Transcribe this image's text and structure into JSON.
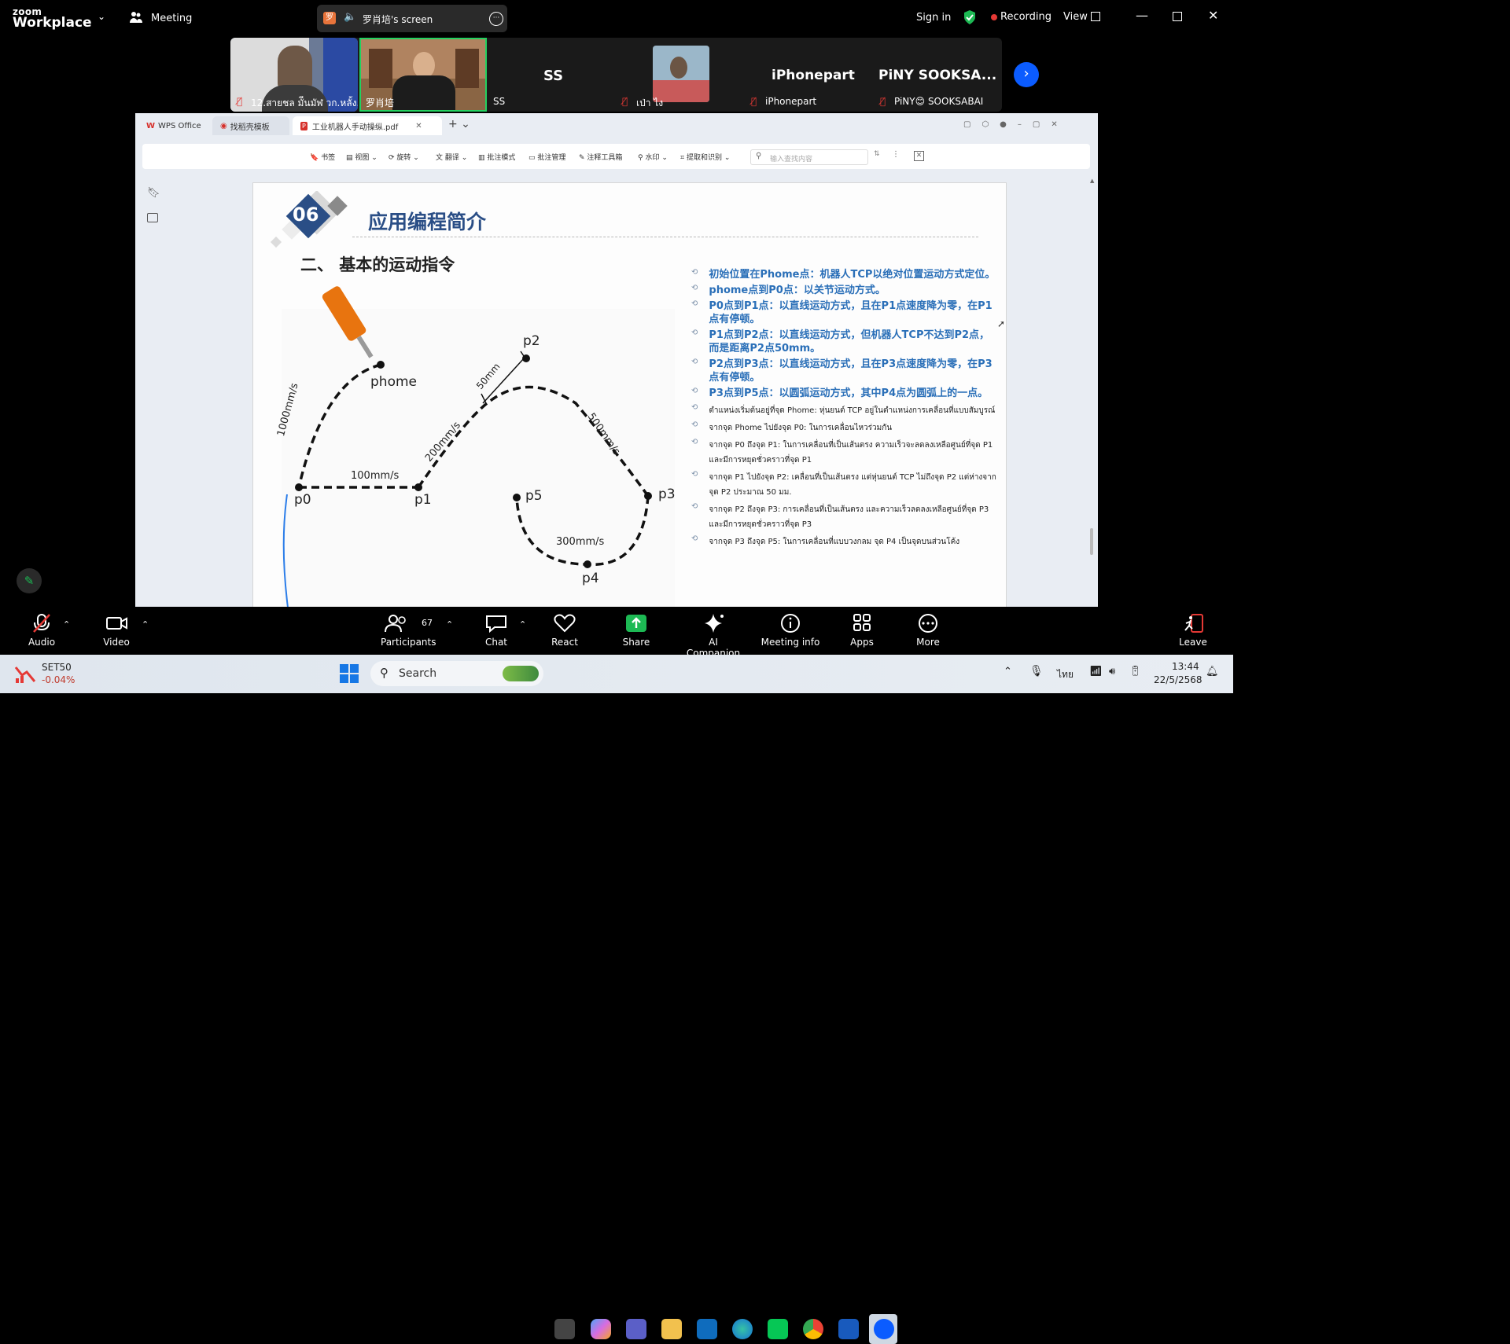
{
  "app": {
    "logo_top": "zoom",
    "logo_bottom": "Workplace",
    "meeting_label": "Meeting",
    "share_title": "罗肖培's screen",
    "sign_in": "Sign in",
    "recording": "Recording",
    "view": "View"
  },
  "thumbnails": [
    {
      "name": "12.สายชล มัีนมัฬ วก.หลั้ง...",
      "muted": true
    },
    {
      "name": "罗肖培",
      "muted": true,
      "active": true
    },
    {
      "name": "SS",
      "big": "SS",
      "muted": false
    },
    {
      "name": "เป่า ไง",
      "muted": true
    },
    {
      "name": "iPhonepart",
      "big": "iPhonepart",
      "muted": true
    },
    {
      "name": "PiNY😊 SOOKSABAI",
      "big": "PiNY󠁿 SOOKSA...",
      "muted": true
    }
  ],
  "wps": {
    "tabs": [
      "WPS Office",
      "找稻壳模板",
      "工业机器人手动操纵.pdf"
    ],
    "tools": [
      "书签",
      "视图",
      "旋转",
      "翻译",
      "批注模式",
      "批注管理",
      "注释工具箱",
      "水印",
      "提取和识别"
    ],
    "search_placeholder": "输入查找内容"
  },
  "slide": {
    "number": "06",
    "title": "应用编程简介",
    "subtitle": "二、 基本的运动指令",
    "diagram": {
      "points": [
        "phome",
        "p0",
        "p1",
        "p2",
        "p3",
        "p4",
        "p5"
      ],
      "speeds": [
        "1000mm/s",
        "100mm/s",
        "200mm/s",
        "50mm",
        "500mm/s",
        "300mm/s"
      ]
    },
    "bullets_cn": [
      "初始位置在Phome点：机器人TCP以绝对位置运动方式定位。",
      "phome点到P0点：以关节运动方式。",
      "P0点到P1点：以直线运动方式，且在P1点速度降为零，在P1点有停顿。",
      "P1点到P2点：以直线运动方式，但机器人TCP不达到P2点，而是距离P2点50mm。",
      "P2点到P3点：以直线运动方式，且在P3点速度降为零，在P3点有停顿。",
      "P3点到P5点：以圆弧运动方式，其中P4点为圆弧上的一点。"
    ],
    "bullets_th": [
      "ตำแหน่งเริ่มต้นอยู่ที่จุด Phome: หุ่นยนต์ TCP อยู่ในตำแหน่งการเคลื่อนที่แบบสัมบูรณ์",
      "จากจุด Phome ไปยังจุด P0: ในการเคลื่อนไหวร่วมกัน",
      "จากจุด P0 ถึงจุด P1: ในการเคลื่อนที่เป็นเส้นตรง ความเร็วจะลดลงเหลือศูนย์ที่จุด P1 และมีการหยุดชั่วคราวที่จุด P1",
      "จากจุด P1 ไปยังจุด P2: เคลื่อนที่เป็นเส้นตรง แต่หุ่นยนต์ TCP ไม่ถึงจุด P2 แต่ห่างจากจุด P2 ประมาณ 50 มม.",
      "จากจุด P2 ถึงจุด P3: การเคลื่อนที่เป็นเส้นตรง และความเร็วลดลงเหลือศูนย์ที่จุด P3 และมีการหยุดชั่วคราวที่จุด P3",
      "จากจุด P3 ถึงจุด P5: ในการเคลื่อนที่แบบวงกลม จุด P4 เป็นจุดบนส่วนโค้ง"
    ]
  },
  "controls": {
    "audio": "Audio",
    "video": "Video",
    "participants": "Participants",
    "participants_count": "67",
    "chat": "Chat",
    "react": "React",
    "share": "Share",
    "ai": "AI Companion",
    "info": "Meeting info",
    "apps": "Apps",
    "more": "More",
    "leave": "Leave"
  },
  "taskbar": {
    "stock_name": "SET50",
    "stock_change": "-0.04%",
    "search": "Search",
    "lang": "ไทย",
    "time": "13:44",
    "date": "22/5/2568"
  },
  "colors": {
    "accent": "#2a6fb8",
    "zoom_blue": "#0b5cff",
    "green": "#1db954",
    "red": "#e53935"
  }
}
